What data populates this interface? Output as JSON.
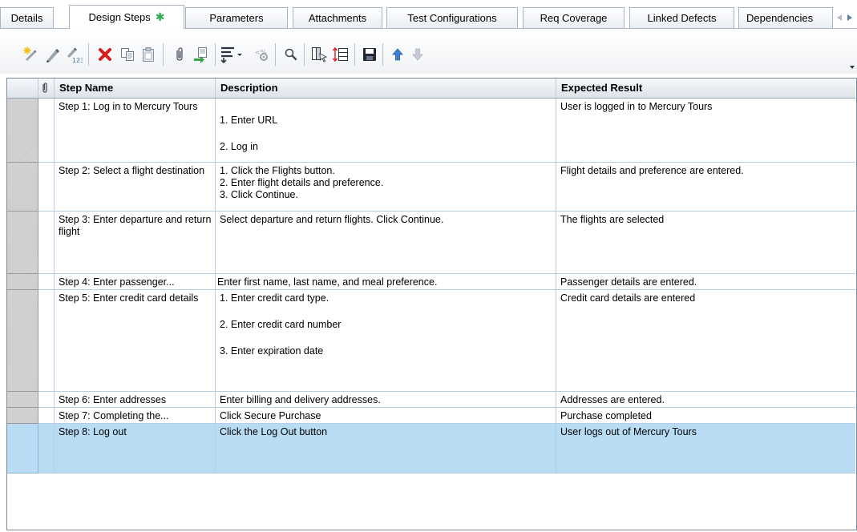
{
  "tabs": [
    {
      "label": "Details",
      "active": false
    },
    {
      "label": "Design Steps",
      "active": true,
      "modified": true
    },
    {
      "label": "Parameters",
      "active": false
    },
    {
      "label": "Attachments",
      "active": false
    },
    {
      "label": "Test Configurations",
      "active": false
    },
    {
      "label": "Req Coverage",
      "active": false
    },
    {
      "label": "Linked Defects",
      "active": false
    },
    {
      "label": "Dependencies",
      "active": false
    }
  ],
  "tab_modified_mark": "✱",
  "toolbar": {
    "items": [
      "new-step-icon",
      "edit-step-icon",
      "renumber-steps-icon",
      "delete-icon",
      "copy-icon",
      "paste-icon",
      "attachment-icon",
      "call-to-test-icon",
      "insert-parameter-icon",
      "generate-script-icon",
      "find-icon",
      "select-columns-icon",
      "adjust-row-height-icon",
      "save-icon",
      "move-up-icon",
      "move-down-icon"
    ]
  },
  "grid": {
    "columns": {
      "step_name": "Step Name",
      "description": "Description",
      "expected_result": "Expected Result"
    },
    "rows": [
      {
        "name": "Step 1: Log in to Mercury Tours",
        "description": [
          "1. Enter URL",
          "2. Log in"
        ],
        "expected": "User is logged in to Mercury Tours"
      },
      {
        "name": "Step 2: Select a flight destination",
        "description": [
          "1. Click the Flights button.",
          "2. Enter flight details and preference.",
          "3. Click Continue."
        ],
        "expected": "Flight details and preference are entered."
      },
      {
        "name": "Step 3: Enter departure and return flight",
        "description": [
          "Select departure and return flights. Click Continue."
        ],
        "expected": "The flights are selected"
      },
      {
        "name": "Step  4:  Enter passenger...",
        "description": [
          "Enter first name, last name, and meal preference."
        ],
        "expected": "Passenger details are entered."
      },
      {
        "name": "Step 5: Enter credit card details",
        "description": [
          "1. Enter credit card type.",
          "2. Enter credit card number",
          "3. Enter expiration date"
        ],
        "expected": "Credit card details are entered"
      },
      {
        "name": "Step 6: Enter addresses",
        "description": [
          "Enter billing and delivery addresses."
        ],
        "expected": "Addresses are entered."
      },
      {
        "name": "Step  7:  Completing  the...",
        "description": [
          "Click Secure Purchase"
        ],
        "expected": "Purchase completed"
      },
      {
        "name": "Step 8: Log out",
        "description": [
          "Click the Log Out button"
        ],
        "expected": "User logs out of Mercury Tours",
        "selected": true
      }
    ]
  },
  "colors": {
    "selected_row": "#b8dcf3",
    "grid_line": "#b5cde6",
    "delete_red": "#d81e1e",
    "modified_star": "#2fa84f"
  }
}
